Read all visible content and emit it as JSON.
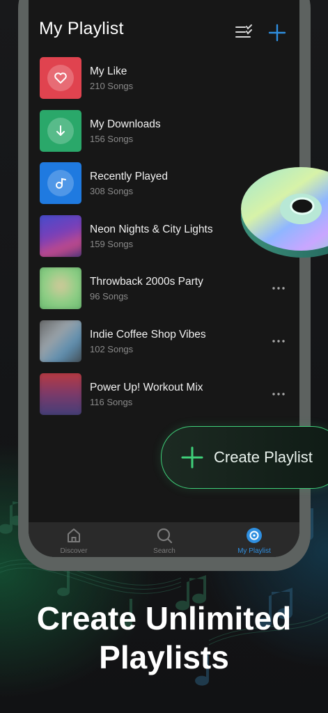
{
  "header": {
    "title": "My Playlist",
    "sort_icon": "list-check-icon",
    "add_icon": "plus-icon",
    "accent": "#2f8fe0"
  },
  "playlists": [
    {
      "name": "My Like",
      "count": "210 Songs",
      "icon": "heart-icon",
      "color": "#e0434f"
    },
    {
      "name": "My Downloads",
      "count": "156 Songs",
      "icon": "download-arrow-icon",
      "color": "#2aa86a"
    },
    {
      "name": "Recently Played",
      "count": "308 Songs",
      "icon": "music-note-icon",
      "color": "#1f7ae0"
    },
    {
      "name": "Neon Nights & City Lights",
      "count": "159 Songs"
    },
    {
      "name": "Throwback 2000s Party",
      "count": "96 Songs",
      "more": "more-dots-icon"
    },
    {
      "name": "Indie Coffee Shop Vibes",
      "count": "102 Songs",
      "more": "more-dots-icon"
    },
    {
      "name": "Power Up! Workout Mix",
      "count": "116 Songs",
      "more": "more-dots-icon"
    }
  ],
  "tabs": [
    {
      "label": "Discover",
      "icon": "home-icon"
    },
    {
      "label": "Search",
      "icon": "search-icon"
    },
    {
      "label": "My Playlist",
      "icon": "disc-icon",
      "active": true
    }
  ],
  "create_button": {
    "label": "Create Playlist",
    "icon": "plus-icon",
    "color": "#3fcf79"
  },
  "headline": {
    "line1": "Create Unlimited",
    "line2": "Playlists"
  }
}
